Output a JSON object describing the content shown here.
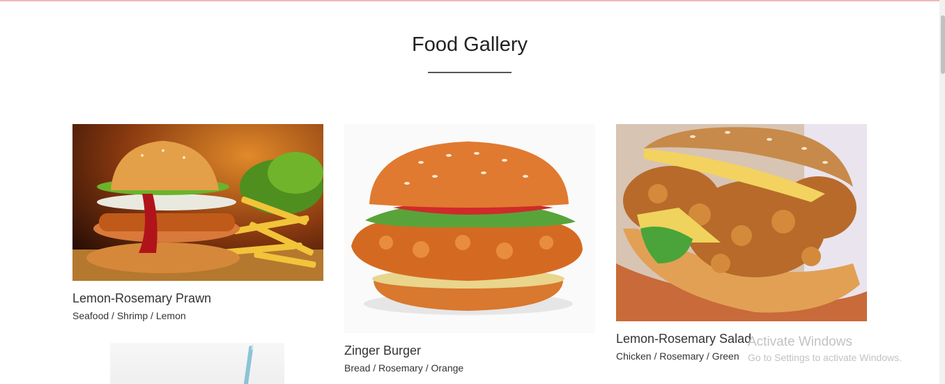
{
  "gallery": {
    "title": "Food Gallery",
    "items": [
      {
        "name": "Lemon-Rosemary Prawn",
        "tags": "Seafood / Shrimp / Lemon",
        "image": "burger-with-fries-photo"
      },
      {
        "name": "Zinger Burger",
        "tags": "Bread / Rosemary / Orange",
        "image": "zinger-burger-photo"
      },
      {
        "name": "Lemon-Rosemary Salad",
        "tags": "Chicken / Rosemary / Green",
        "image": "crispy-chicken-burger-photo"
      },
      {
        "image": "drink-with-straw-photo"
      }
    ]
  },
  "watermark": {
    "title": "Activate Windows",
    "subtitle": "Go to Settings to activate Windows."
  },
  "colors": {
    "accent_strip": "#f0b8b8",
    "title_rule": "#555555",
    "text": "#333333"
  }
}
